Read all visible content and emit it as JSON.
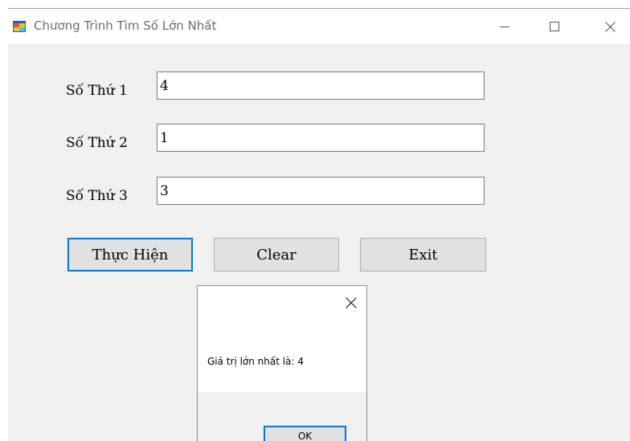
{
  "window": {
    "title": "Chương Trình Tìm Số Lớn Nhất"
  },
  "form": {
    "fields": [
      {
        "label": "Số Thứ 1",
        "value": "4"
      },
      {
        "label": "Số Thứ 2",
        "value": "1"
      },
      {
        "label": "Số Thứ 3",
        "value": "3"
      }
    ],
    "buttons": {
      "execute_label": "Thực Hiện",
      "clear_label": "Clear",
      "exit_label": "Exit"
    }
  },
  "message_box": {
    "text": "Giá trị lớn nhất là: 4",
    "ok_label": "OK"
  },
  "colors": {
    "accent": "#0078d7",
    "window_bg": "#f0f0f0",
    "button_bg": "#e1e1e1"
  }
}
